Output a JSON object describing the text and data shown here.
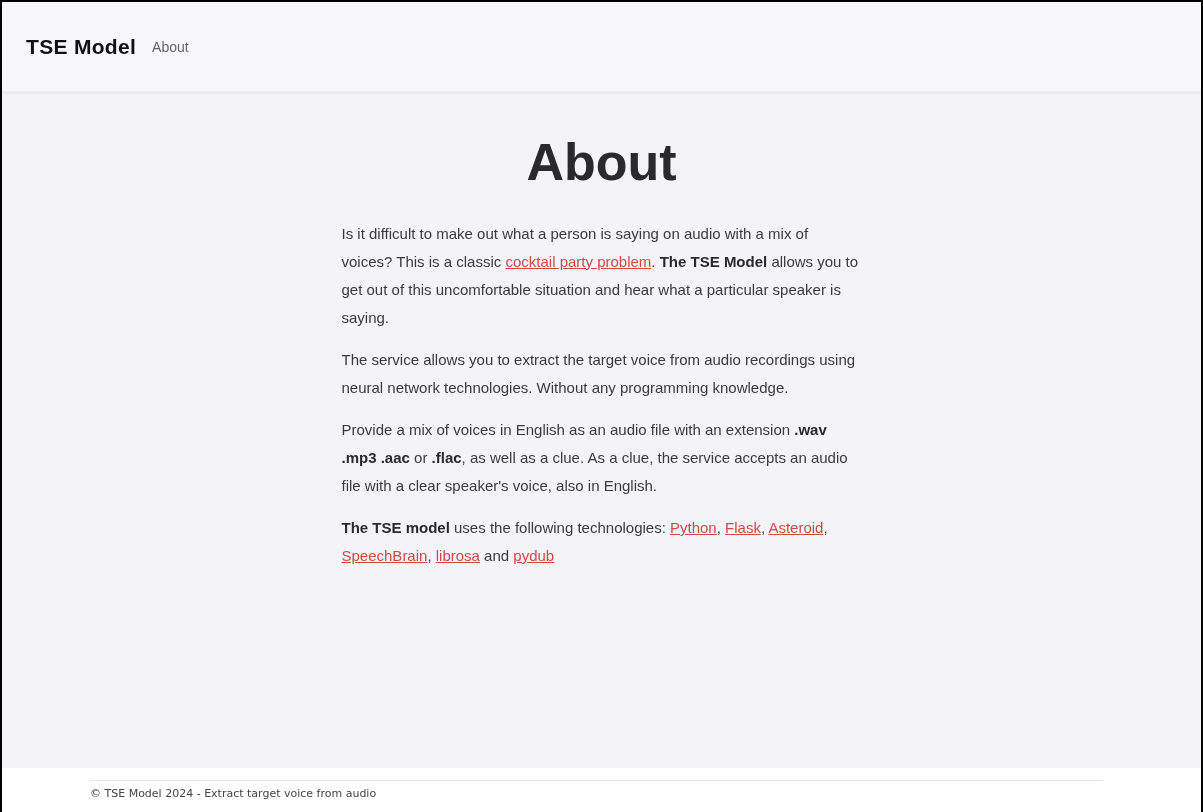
{
  "navbar": {
    "brand": "TSE Model",
    "links": [
      {
        "label": "About"
      }
    ]
  },
  "title": "About",
  "paragraphs": [
    [
      {
        "kind": "text",
        "text": "Is it difficult to make out what a person is saying on audio with a mix of voices? This is a classic "
      },
      {
        "kind": "link",
        "text": "cocktail party problem"
      },
      {
        "kind": "text",
        "text": ". "
      },
      {
        "kind": "bold",
        "text": "The TSE Model"
      },
      {
        "kind": "text",
        "text": " allows you to get out of this uncomfortable situation and hear what a particular speaker is saying."
      }
    ],
    [
      {
        "kind": "text",
        "text": "The service allows you to extract the target voice from audio recordings using neural network technologies. Without any programming knowledge."
      }
    ],
    [
      {
        "kind": "text",
        "text": "Provide a mix of voices in English as an audio file with an extension "
      },
      {
        "kind": "bold",
        "text": ".wav .mp3 .aac"
      },
      {
        "kind": "text",
        "text": " or "
      },
      {
        "kind": "bold",
        "text": ".flac"
      },
      {
        "kind": "text",
        "text": ", as well as a clue. As a clue, the service accepts an audio file with a clear speaker's voice, also in English."
      }
    ],
    [
      {
        "kind": "bold",
        "text": "The TSE model"
      },
      {
        "kind": "text",
        "text": " uses the following technologies: "
      },
      {
        "kind": "link",
        "text": "Python"
      },
      {
        "kind": "text",
        "text": ", "
      },
      {
        "kind": "link",
        "text": "Flask"
      },
      {
        "kind": "text",
        "text": ", "
      },
      {
        "kind": "link",
        "text": "Asteroid"
      },
      {
        "kind": "text",
        "text": ", "
      },
      {
        "kind": "link",
        "text": "SpeechBrain"
      },
      {
        "kind": "text",
        "text": ", "
      },
      {
        "kind": "link",
        "text": "librosa"
      },
      {
        "kind": "text",
        "text": " and "
      },
      {
        "kind": "link",
        "text": "pydub"
      }
    ]
  ],
  "footer": "© TSE Model 2024 - Extract target voice from audio"
}
